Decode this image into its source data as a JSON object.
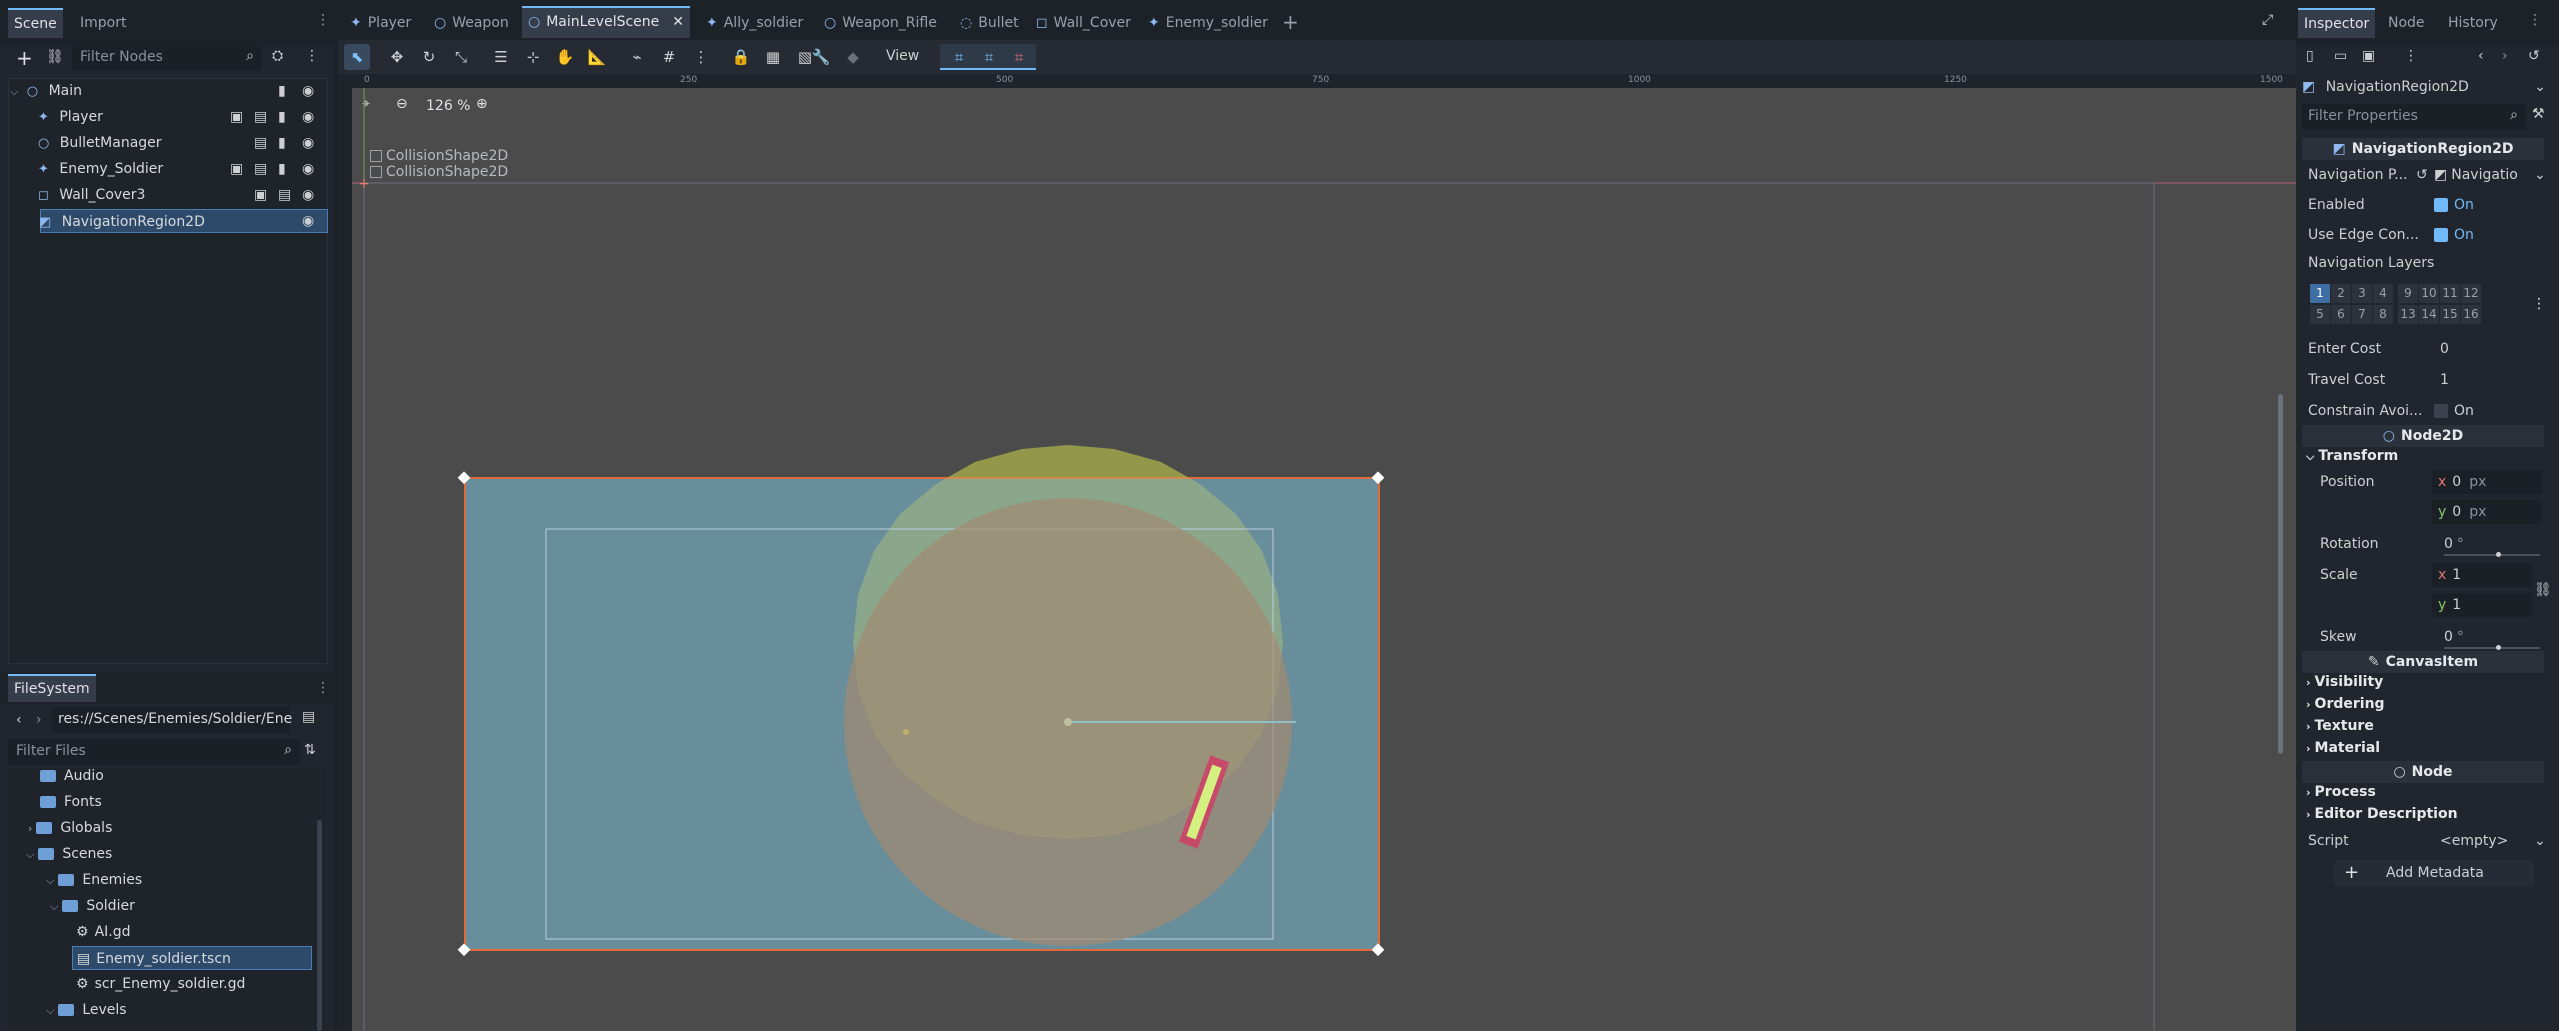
{
  "left_dock": {
    "tabs": [
      "Scene",
      "Import"
    ],
    "filter_placeholder": "Filter Nodes",
    "nodes": [
      {
        "label": "Main"
      },
      {
        "label": "Player"
      },
      {
        "label": "BulletManager"
      },
      {
        "label": "Enemy_Soldier"
      },
      {
        "label": "Wall_Cover3"
      },
      {
        "label": "NavigationRegion2D"
      }
    ]
  },
  "filesystem": {
    "title": "FileSystem",
    "path": "res://Scenes/Enemies/Soldier/Ene",
    "filter_placeholder": "Filter Files",
    "items": [
      {
        "label": "Audio"
      },
      {
        "label": "Fonts"
      },
      {
        "label": "Globals"
      },
      {
        "label": "Scenes"
      },
      {
        "label": "Enemies"
      },
      {
        "label": "Soldier"
      },
      {
        "label": "AI.gd"
      },
      {
        "label": "Enemy_soldier.tscn"
      },
      {
        "label": "scr_Enemy_soldier.gd"
      },
      {
        "label": "Levels"
      }
    ]
  },
  "scene_tabs": [
    "Player",
    "Weapon",
    "MainLevelScene",
    "Ally_soldier",
    "Weapon_Rifle",
    "Bullet",
    "Wall_Cover",
    "Enemy_soldier"
  ],
  "toolbar": {
    "view_label": "View"
  },
  "viewport": {
    "zoom": "126 %",
    "ruler_labels": [
      "0",
      "250",
      "500",
      "750",
      "1000",
      "1250",
      "1500"
    ],
    "overlay_items": [
      "CollisionShape2D",
      "CollisionShape2D"
    ]
  },
  "inspector": {
    "tabs": [
      "Inspector",
      "Node",
      "History"
    ],
    "node_selector": "NavigationRegion2D",
    "filter_placeholder": "Filter Properties",
    "class_header": "NavigationRegion2D",
    "nav_poly_label": "Navigation P...",
    "nav_poly_value": "Navigatio",
    "enabled_label": "Enabled",
    "enabled_value": "On",
    "edge_label": "Use Edge Con...",
    "edge_value": "On",
    "nav_layers_label": "Navigation Layers",
    "layers_row1": [
      "1",
      "2",
      "3",
      "4",
      "9",
      "10",
      "11",
      "12"
    ],
    "layers_row2": [
      "5",
      "6",
      "7",
      "8",
      "13",
      "14",
      "15",
      "16"
    ],
    "enter_cost_label": "Enter Cost",
    "enter_cost": "0",
    "travel_cost_label": "Travel Cost",
    "travel_cost": "1",
    "constrain_label": "Constrain Avoi...",
    "constrain_value": "On",
    "node2d_header": "Node2D",
    "transform_label": "Transform",
    "position_label": "Position",
    "pos_x": "0",
    "pos_y": "0",
    "px_unit": "px",
    "rotation_label": "Rotation",
    "rotation": "0",
    "scale_label": "Scale",
    "scale_x": "1",
    "scale_y": "1",
    "skew_label": "Skew",
    "skew": "0",
    "deg_unit": "°",
    "canvasitem_header": "CanvasItem",
    "visibility_label": "Visibility",
    "ordering_label": "Ordering",
    "texture_label": "Texture",
    "material_label": "Material",
    "node_header": "Node",
    "process_label": "Process",
    "editor_desc_label": "Editor Description",
    "script_label": "Script",
    "script_value": "<empty>",
    "add_metadata_label": "Add Metadata"
  },
  "colors": {
    "accent": "#70bafa",
    "viewport_bg": "#4b4b4b",
    "nav_region": "#6f9fb0",
    "enemy_range": "#8a8a2a",
    "selection_outline": "#e06a3a"
  }
}
